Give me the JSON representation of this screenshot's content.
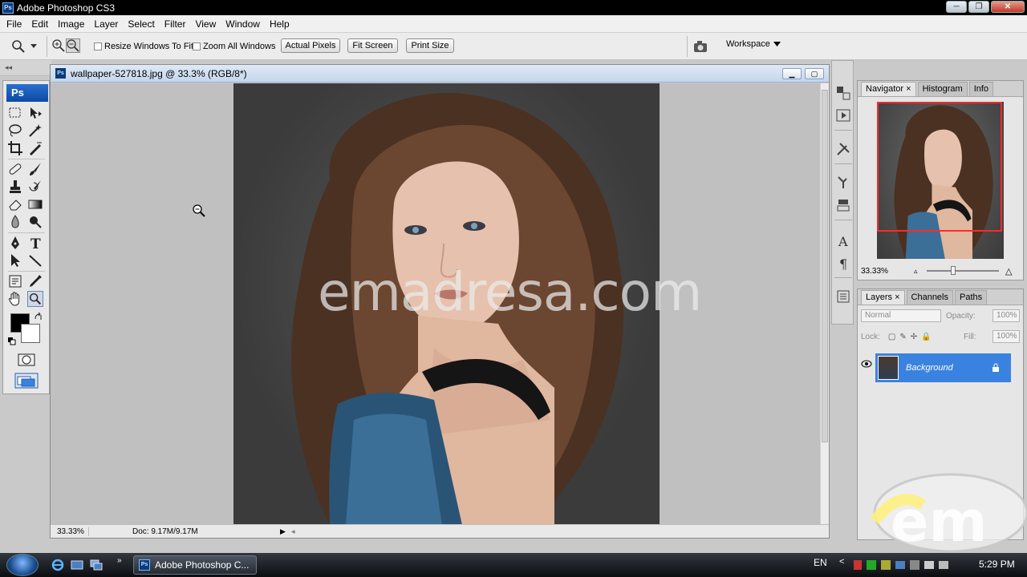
{
  "window": {
    "title": "Adobe Photoshop CS3",
    "controls": [
      "─",
      "❐",
      "✕"
    ]
  },
  "menu": [
    "File",
    "Edit",
    "Image",
    "Layer",
    "Select",
    "Filter",
    "View",
    "Window",
    "Help"
  ],
  "options": {
    "resize_windows": "Resize Windows To Fit",
    "zoom_all": "Zoom All Windows",
    "actual_pixels": "Actual Pixels",
    "fit_screen": "Fit Screen",
    "print_size": "Print Size",
    "workspace": "Workspace"
  },
  "tools": {
    "logo": "Ps"
  },
  "document": {
    "title": "wallpaper-527818.jpg @ 33.3% (RGB/8*)",
    "zoom": "33.33%",
    "doc_size": "Doc: 9.17M/9.17M"
  },
  "watermark": "emadresa.com",
  "navigator": {
    "tabs": [
      "Navigator",
      "Histogram",
      "Info"
    ],
    "zoom": "33.33%"
  },
  "layers": {
    "tabs": [
      "Layers",
      "Channels",
      "Paths"
    ],
    "blend_mode": "Normal",
    "opacity_label": "Opacity:",
    "opacity": "100%",
    "lock_label": "Lock:",
    "fill_label": "Fill:",
    "fill": "100%",
    "layer_name": "Background"
  },
  "taskbar": {
    "task": "Adobe Photoshop C...",
    "lang": "EN",
    "time": "5:29 PM"
  },
  "colors": {
    "accent": "#3a82e0",
    "title_bar": "#000000",
    "nav_rect": "#ff2a2a"
  }
}
